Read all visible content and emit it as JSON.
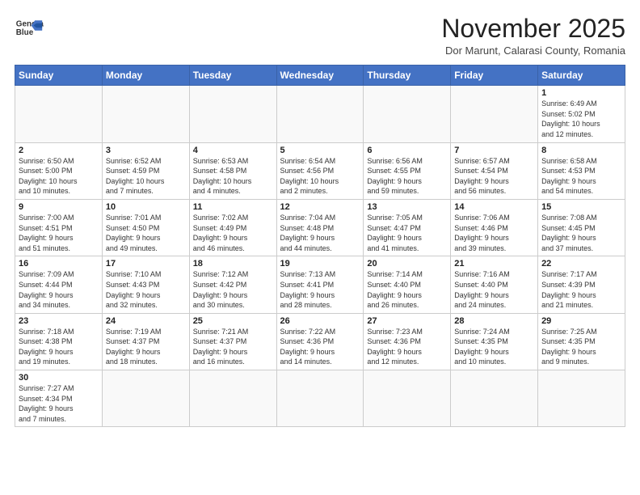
{
  "logo": {
    "line1": "General",
    "line2": "Blue"
  },
  "title": "November 2025",
  "subtitle": "Dor Marunt, Calarasi County, Romania",
  "headers": [
    "Sunday",
    "Monday",
    "Tuesday",
    "Wednesday",
    "Thursday",
    "Friday",
    "Saturday"
  ],
  "weeks": [
    [
      {
        "day": "",
        "info": ""
      },
      {
        "day": "",
        "info": ""
      },
      {
        "day": "",
        "info": ""
      },
      {
        "day": "",
        "info": ""
      },
      {
        "day": "",
        "info": ""
      },
      {
        "day": "",
        "info": ""
      },
      {
        "day": "1",
        "info": "Sunrise: 6:49 AM\nSunset: 5:02 PM\nDaylight: 10 hours\nand 12 minutes."
      }
    ],
    [
      {
        "day": "2",
        "info": "Sunrise: 6:50 AM\nSunset: 5:00 PM\nDaylight: 10 hours\nand 10 minutes."
      },
      {
        "day": "3",
        "info": "Sunrise: 6:52 AM\nSunset: 4:59 PM\nDaylight: 10 hours\nand 7 minutes."
      },
      {
        "day": "4",
        "info": "Sunrise: 6:53 AM\nSunset: 4:58 PM\nDaylight: 10 hours\nand 4 minutes."
      },
      {
        "day": "5",
        "info": "Sunrise: 6:54 AM\nSunset: 4:56 PM\nDaylight: 10 hours\nand 2 minutes."
      },
      {
        "day": "6",
        "info": "Sunrise: 6:56 AM\nSunset: 4:55 PM\nDaylight: 9 hours\nand 59 minutes."
      },
      {
        "day": "7",
        "info": "Sunrise: 6:57 AM\nSunset: 4:54 PM\nDaylight: 9 hours\nand 56 minutes."
      },
      {
        "day": "8",
        "info": "Sunrise: 6:58 AM\nSunset: 4:53 PM\nDaylight: 9 hours\nand 54 minutes."
      }
    ],
    [
      {
        "day": "9",
        "info": "Sunrise: 7:00 AM\nSunset: 4:51 PM\nDaylight: 9 hours\nand 51 minutes."
      },
      {
        "day": "10",
        "info": "Sunrise: 7:01 AM\nSunset: 4:50 PM\nDaylight: 9 hours\nand 49 minutes."
      },
      {
        "day": "11",
        "info": "Sunrise: 7:02 AM\nSunset: 4:49 PM\nDaylight: 9 hours\nand 46 minutes."
      },
      {
        "day": "12",
        "info": "Sunrise: 7:04 AM\nSunset: 4:48 PM\nDaylight: 9 hours\nand 44 minutes."
      },
      {
        "day": "13",
        "info": "Sunrise: 7:05 AM\nSunset: 4:47 PM\nDaylight: 9 hours\nand 41 minutes."
      },
      {
        "day": "14",
        "info": "Sunrise: 7:06 AM\nSunset: 4:46 PM\nDaylight: 9 hours\nand 39 minutes."
      },
      {
        "day": "15",
        "info": "Sunrise: 7:08 AM\nSunset: 4:45 PM\nDaylight: 9 hours\nand 37 minutes."
      }
    ],
    [
      {
        "day": "16",
        "info": "Sunrise: 7:09 AM\nSunset: 4:44 PM\nDaylight: 9 hours\nand 34 minutes."
      },
      {
        "day": "17",
        "info": "Sunrise: 7:10 AM\nSunset: 4:43 PM\nDaylight: 9 hours\nand 32 minutes."
      },
      {
        "day": "18",
        "info": "Sunrise: 7:12 AM\nSunset: 4:42 PM\nDaylight: 9 hours\nand 30 minutes."
      },
      {
        "day": "19",
        "info": "Sunrise: 7:13 AM\nSunset: 4:41 PM\nDaylight: 9 hours\nand 28 minutes."
      },
      {
        "day": "20",
        "info": "Sunrise: 7:14 AM\nSunset: 4:40 PM\nDaylight: 9 hours\nand 26 minutes."
      },
      {
        "day": "21",
        "info": "Sunrise: 7:16 AM\nSunset: 4:40 PM\nDaylight: 9 hours\nand 24 minutes."
      },
      {
        "day": "22",
        "info": "Sunrise: 7:17 AM\nSunset: 4:39 PM\nDaylight: 9 hours\nand 21 minutes."
      }
    ],
    [
      {
        "day": "23",
        "info": "Sunrise: 7:18 AM\nSunset: 4:38 PM\nDaylight: 9 hours\nand 19 minutes."
      },
      {
        "day": "24",
        "info": "Sunrise: 7:19 AM\nSunset: 4:37 PM\nDaylight: 9 hours\nand 18 minutes."
      },
      {
        "day": "25",
        "info": "Sunrise: 7:21 AM\nSunset: 4:37 PM\nDaylight: 9 hours\nand 16 minutes."
      },
      {
        "day": "26",
        "info": "Sunrise: 7:22 AM\nSunset: 4:36 PM\nDaylight: 9 hours\nand 14 minutes."
      },
      {
        "day": "27",
        "info": "Sunrise: 7:23 AM\nSunset: 4:36 PM\nDaylight: 9 hours\nand 12 minutes."
      },
      {
        "day": "28",
        "info": "Sunrise: 7:24 AM\nSunset: 4:35 PM\nDaylight: 9 hours\nand 10 minutes."
      },
      {
        "day": "29",
        "info": "Sunrise: 7:25 AM\nSunset: 4:35 PM\nDaylight: 9 hours\nand 9 minutes."
      }
    ],
    [
      {
        "day": "30",
        "info": "Sunrise: 7:27 AM\nSunset: 4:34 PM\nDaylight: 9 hours\nand 7 minutes."
      },
      {
        "day": "",
        "info": ""
      },
      {
        "day": "",
        "info": ""
      },
      {
        "day": "",
        "info": ""
      },
      {
        "day": "",
        "info": ""
      },
      {
        "day": "",
        "info": ""
      },
      {
        "day": "",
        "info": ""
      }
    ]
  ]
}
